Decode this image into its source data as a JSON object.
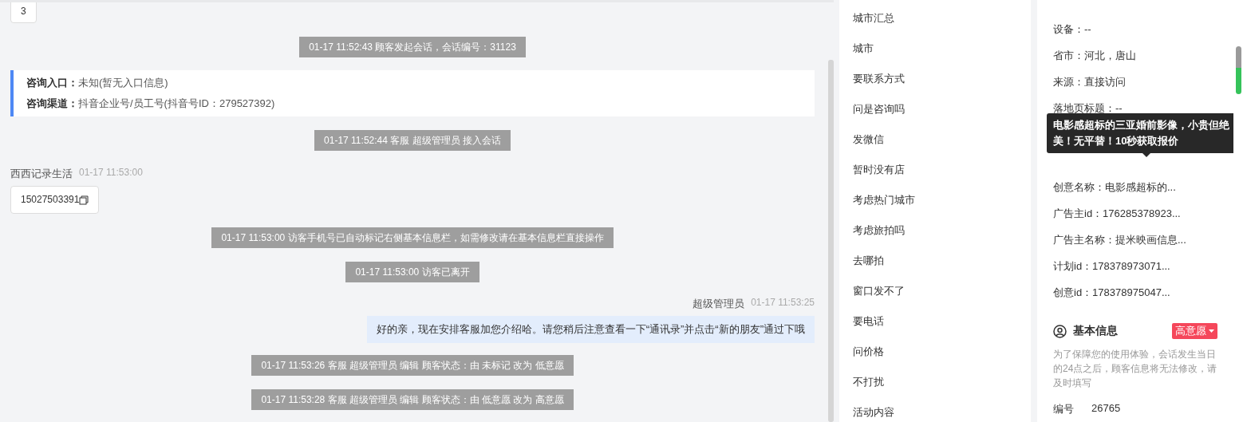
{
  "chat": {
    "messages": [
      {
        "kind": "customer-bubble",
        "text": "3"
      },
      {
        "kind": "system",
        "text": "01-17 11:52:43 顾客发起会话，会话编号：31123"
      },
      {
        "kind": "source-card",
        "lines": [
          {
            "label": "咨询入口：",
            "value": "未知(暂无入口信息)"
          },
          {
            "label": "咨询渠道：",
            "value": "抖音企业号/员工号(抖音号ID：279527392)"
          }
        ]
      },
      {
        "kind": "system",
        "text": "01-17 11:52:44 客服 超级管理员 接入会话"
      },
      {
        "kind": "customer-header",
        "name": "西西记录生活",
        "time": "01-17 11:53:00"
      },
      {
        "kind": "phone-bubble",
        "text": "15027503391"
      },
      {
        "kind": "system",
        "text": "01-17 11:53:00 访客手机号已自动标记右侧基本信息栏，如需修改请在基本信息栏直接操作"
      },
      {
        "kind": "system",
        "text": "01-17 11:53:00 访客已离开"
      },
      {
        "kind": "agent-header",
        "name": "超级管理员",
        "time": "01-17 11:53:25"
      },
      {
        "kind": "agent-bubble",
        "text": "好的亲，现在安排客服加您介绍哈。请您稍后注意查看一下“通讯录”并点击“新的朋友”通过下哦"
      },
      {
        "kind": "system",
        "text": "01-17 11:53:26 客服 超级管理员 编辑 顾客状态：由 未标记 改为 低意愿"
      },
      {
        "kind": "system",
        "text": "01-17 11:53:28 客服 超级管理员 编辑 顾客状态：由 低意愿 改为 高意愿"
      }
    ]
  },
  "quick_replies": [
    "城市汇总",
    "城市",
    "要联系方式",
    "问是咨询吗",
    "发微信",
    "暂时没有店",
    "考虑热门城市",
    "考虑旅拍吗",
    "去哪拍",
    "窗口发不了",
    "要电话",
    "问价格",
    "不打扰",
    "活动内容"
  ],
  "detail_info": {
    "rows": [
      {
        "text": "设备：--"
      },
      {
        "text": "省市：河北，唐山"
      },
      {
        "text": "来源：直接访问"
      },
      {
        "text": "落地页标题：--"
      },
      {
        "kind": "tooltip",
        "text": "电影感超标的三亚婚前影像，小贵但绝美！无平替！10秒获取报价"
      },
      {
        "text": "创意名称：电影感超标的..."
      },
      {
        "text": "广告主id：176285378923..."
      },
      {
        "text": "广告主名称：提米映画信息..."
      },
      {
        "text": "计划id：178378973071..."
      },
      {
        "text": "创意id：178378975047..."
      }
    ]
  },
  "basic_info": {
    "title": "基本信息",
    "status": "高意愿",
    "note": "为了保障您的使用体验，会话发生当日的24点之后，顾客信息将无法修改，请及时填写",
    "fields": [
      {
        "label": "编号",
        "value": "26765"
      }
    ]
  }
}
